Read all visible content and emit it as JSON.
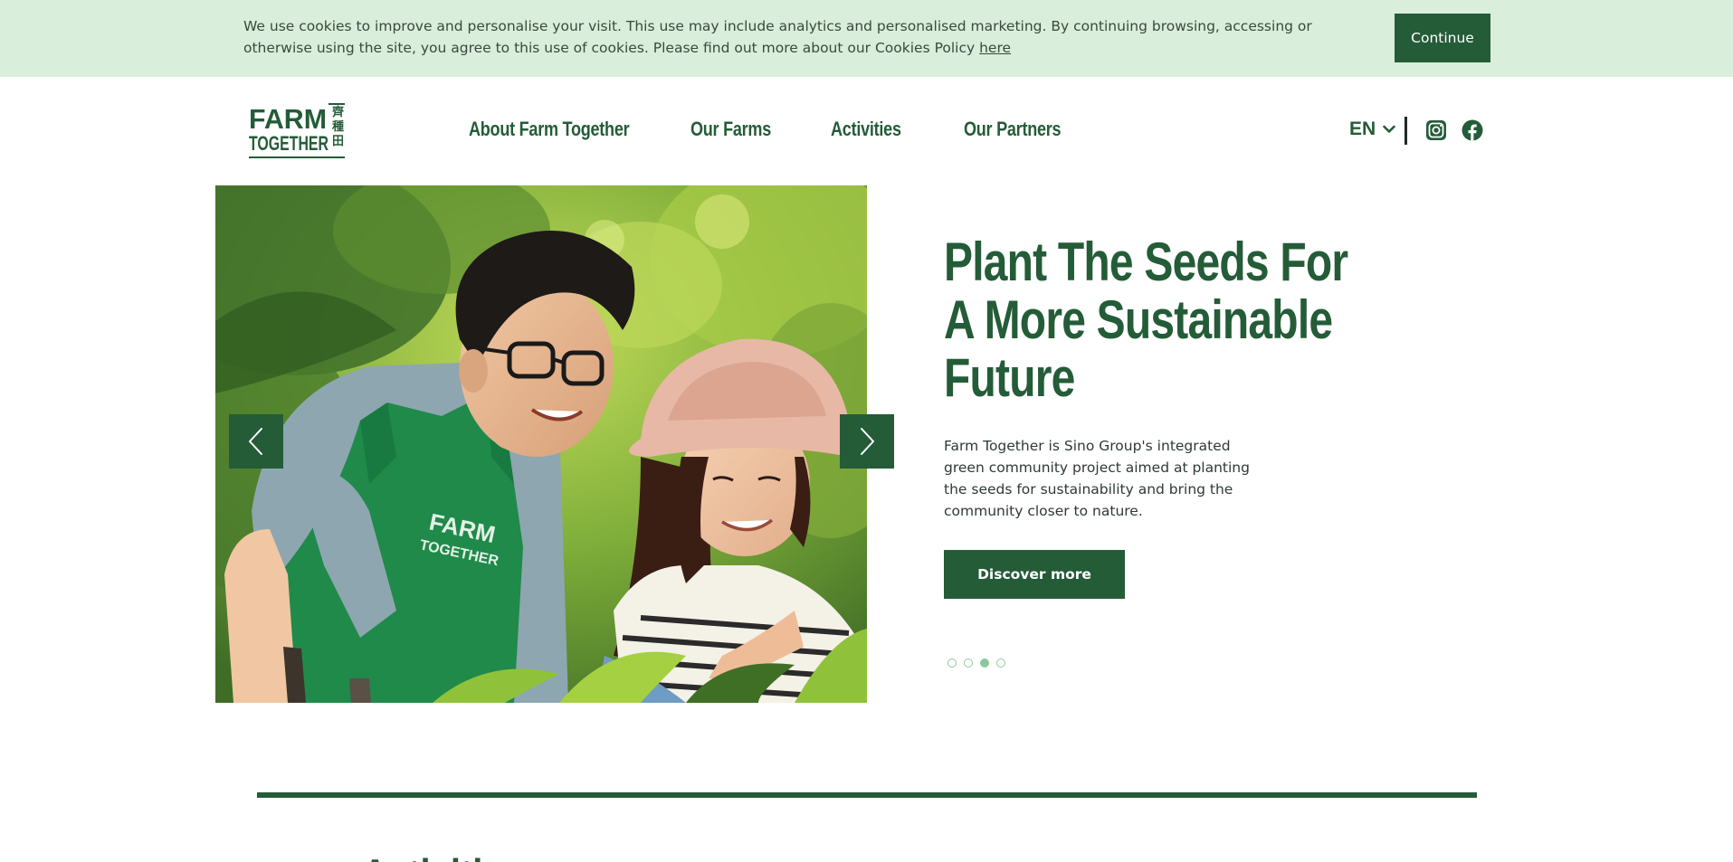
{
  "cookie_bar": {
    "message": "We use cookies to improve and personalise your visit. This use may include analytics and personalised marketing. By continuing browsing, accessing or otherwise using the site, you agree to this use of cookies. Please find out more about our Cookies Policy ",
    "link_text": "here",
    "continue_label": "Continue"
  },
  "header": {
    "logo": {
      "line1": "FARM",
      "line2": "TOGETHER",
      "chinese": "齊種田"
    },
    "nav": [
      {
        "label": "About Farm Together"
      },
      {
        "label": "Our Farms"
      },
      {
        "label": "Activities"
      },
      {
        "label": "Our Partners"
      }
    ],
    "language": "EN",
    "social": [
      "instagram-icon",
      "facebook-icon"
    ]
  },
  "hero": {
    "title": "Plant The Seeds For A More Sustainable Future",
    "description": "Farm Together is Sino Group's integrated green community project aimed at planting the seeds for sustainability and bring the community closer to nature.",
    "cta_label": "Discover more",
    "slide_count": 4,
    "active_slide": 3,
    "apron_text_1": "FARM",
    "apron_text_2": "TOGETHER"
  },
  "next_section": {
    "heading": "Activities"
  },
  "colors": {
    "brand_green": "#245c38",
    "cookie_bg": "#d9eedb",
    "dot_green": "#8cc99a"
  }
}
